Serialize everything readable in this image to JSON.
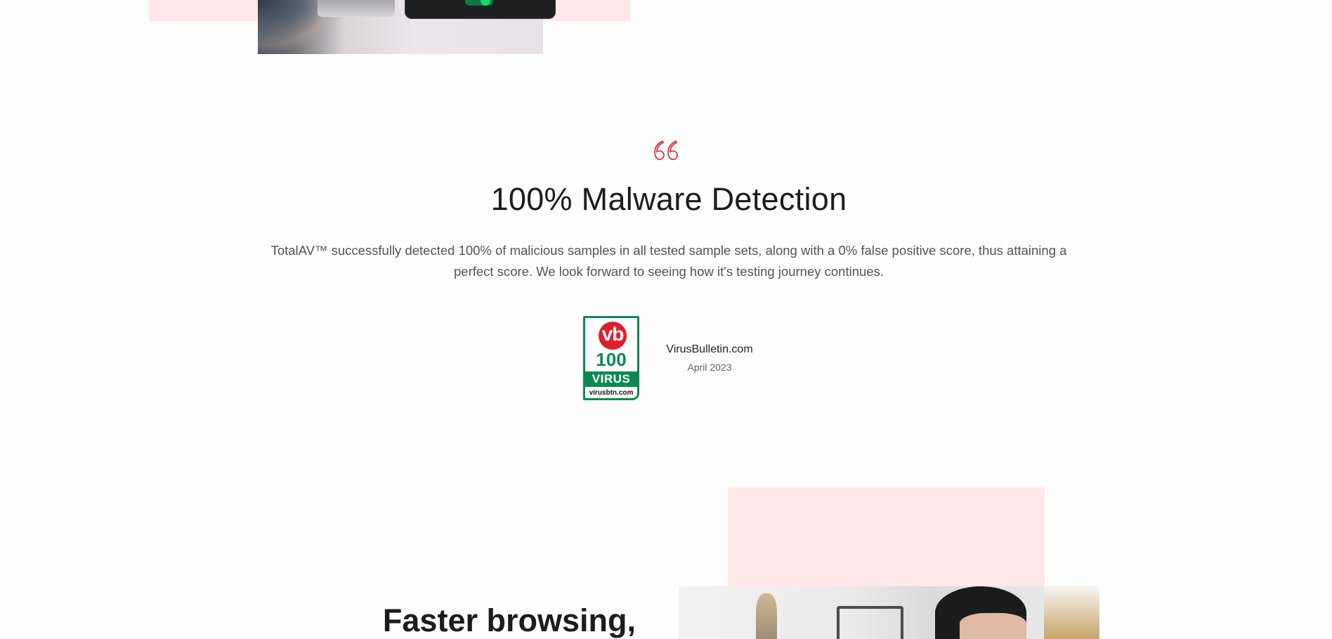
{
  "colors": {
    "brand_pink": "#ffe8e8",
    "quote_red": "#dc1f2a",
    "vb_green": "#0a8a52",
    "text_dark": "#1c1c1c",
    "text_muted": "#50545a"
  },
  "testimonial": {
    "quote_icon": "quote-icon",
    "heading": "100% Malware Detection",
    "body": "TotalAV™ successfully detected 100% of malicious samples in all tested sample sets, along with a 0% false positive score, thus attaining a perfect score. We look forward to seeing how it's testing journey continues.",
    "badge": {
      "logo_text": "vb",
      "score": "100",
      "label": "VIRUS",
      "site": "virusbtn.com"
    },
    "source_name": "VirusBulletin.com",
    "source_date": "April 2023"
  },
  "next_section": {
    "heading_partial": "Faster browsing,"
  }
}
